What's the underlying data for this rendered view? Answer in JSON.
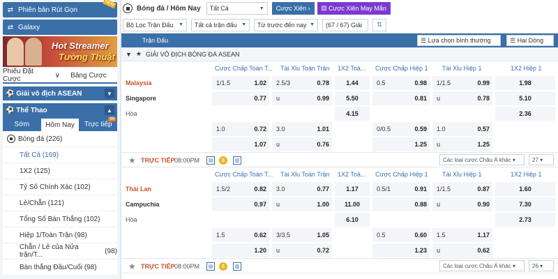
{
  "sidebar": {
    "btn1": "Phiên bản Rút Gọn",
    "btn1_badge": "NEW",
    "btn2": "Galaxy",
    "banner1": "Hot Streamer",
    "banner2": "Tường Thuật",
    "tabs": [
      "Phiếu Đặt Cược",
      "Bảng Cược"
    ],
    "asean": "Giải vô địch ASEAN",
    "sports": "Thể Thao",
    "subtabs": [
      "Sớm",
      "Hôm Nay",
      "Trực tiếp"
    ],
    "live_badge": "99",
    "football": "Bóng đá (226)",
    "items": [
      "Tất Cả (169)",
      "1X2 (125)",
      "Tỷ Số Chính Xác (102)",
      "Lẻ/Chẵn (121)",
      "Tổng Số Bàn Thắng (102)",
      "Hiệp 1/Toàn Trận (98)",
      "Chẵn / Lẻ của Nửa trận/T...",
      "(98)",
      "Bàn thắng Đầu/Cuối (98)"
    ]
  },
  "top": {
    "title": "Bóng đá / Hôm Nay",
    "select": "Tất Cả",
    "btn_xien": "Cược Xiên",
    "btn_may": "Cược Xiên May Mắn"
  },
  "filters": {
    "f1": "Bộ Lọc Trận Đấu",
    "f2": "Tất cả trận đấu",
    "f3": "Từ trước đến nay",
    "count": "(67 / 67) Giải"
  },
  "header": {
    "label": "Trận Đấu",
    "sort": "Lựa chọn bình thường",
    "lines": "Hai Dòng"
  },
  "league": "GIẢI VÔ ĐỊCH BÓNG ĐÁ ASEAN",
  "columns": [
    "Cược Chấp Toàn T...",
    "Tài Xỉu Toàn Trận",
    "1X2 Toà...",
    "Cược Chấp Hiệp 1",
    "Tài Xỉu Hiệp 1",
    "1X2 Hiệp 1"
  ],
  "match1": {
    "home": "Malaysia",
    "away": "Singapore",
    "draw": "Hòa",
    "r1": {
      "hc": "1/1.5",
      "hco": "1.02",
      "ou": "2.5/3",
      "ouo": "0.78",
      "x": "1.44",
      "h1": "0.5",
      "h1o": "0.98",
      "ou1": "1/1.5",
      "ou1o": "0.99",
      "x1": "1.98"
    },
    "r2": {
      "hco": "0.77",
      "ou": "u",
      "ouo": "0.99",
      "x": "5.50",
      "h1o": "0.81",
      "ou1": "u",
      "ou1o": "0.78",
      "x1": "5.10"
    },
    "r3": {
      "x": "4.15",
      "x1": "2.36"
    },
    "r4": {
      "hc": "1.0",
      "hco": "0.72",
      "ou": "3.0",
      "ouo": "1.01",
      "h1": "0/0.5",
      "h1o": "0.59",
      "ou1": "1.0",
      "ou1o": "0.57"
    },
    "r5": {
      "hco": "1.07",
      "ou": "u",
      "ouo": "0.76",
      "h1o": "1.25",
      "ou1": "u",
      "ou1o": "1.25"
    },
    "live": "TRỰC TIẾP",
    "time": "08:00PM",
    "sel": "Các loại cược Châu Á khác",
    "more": "27"
  },
  "match2": {
    "home": "Thái Lan",
    "away": "Campuchia",
    "draw": "Hòa",
    "r1": {
      "hc": "1.5/2",
      "hco": "0.82",
      "ou": "3.0",
      "ouo": "0.77",
      "x": "1.17",
      "h1": "0.5/1",
      "h1o": "0.91",
      "ou1": "1/1.5",
      "ou1o": "0.87",
      "x1": "1.60"
    },
    "r2": {
      "hco": "0.97",
      "ou": "u",
      "ouo": "1.00",
      "x": "11.00",
      "h1o": "0.88",
      "ou1": "u",
      "ou1o": "0.90",
      "x1": "7.30"
    },
    "r3": {
      "x": "6.10",
      "x1": "2.73"
    },
    "r4": {
      "hc": "1.5",
      "hco": "0.62",
      "ou": "3/3.5",
      "ouo": "1.05",
      "h1": "0.5",
      "h1o": "0.60",
      "ou1": "1.5",
      "ou1o": "1.17"
    },
    "r5": {
      "hco": "1.20",
      "ou": "u",
      "ouo": "0.72",
      "h1o": "1.23",
      "ou1": "u",
      "ou1o": "0.62"
    },
    "live": "TRỰC TIẾP",
    "time": "08:00PM",
    "sel": "Các loại cược Châu Á khác",
    "more": "26"
  }
}
